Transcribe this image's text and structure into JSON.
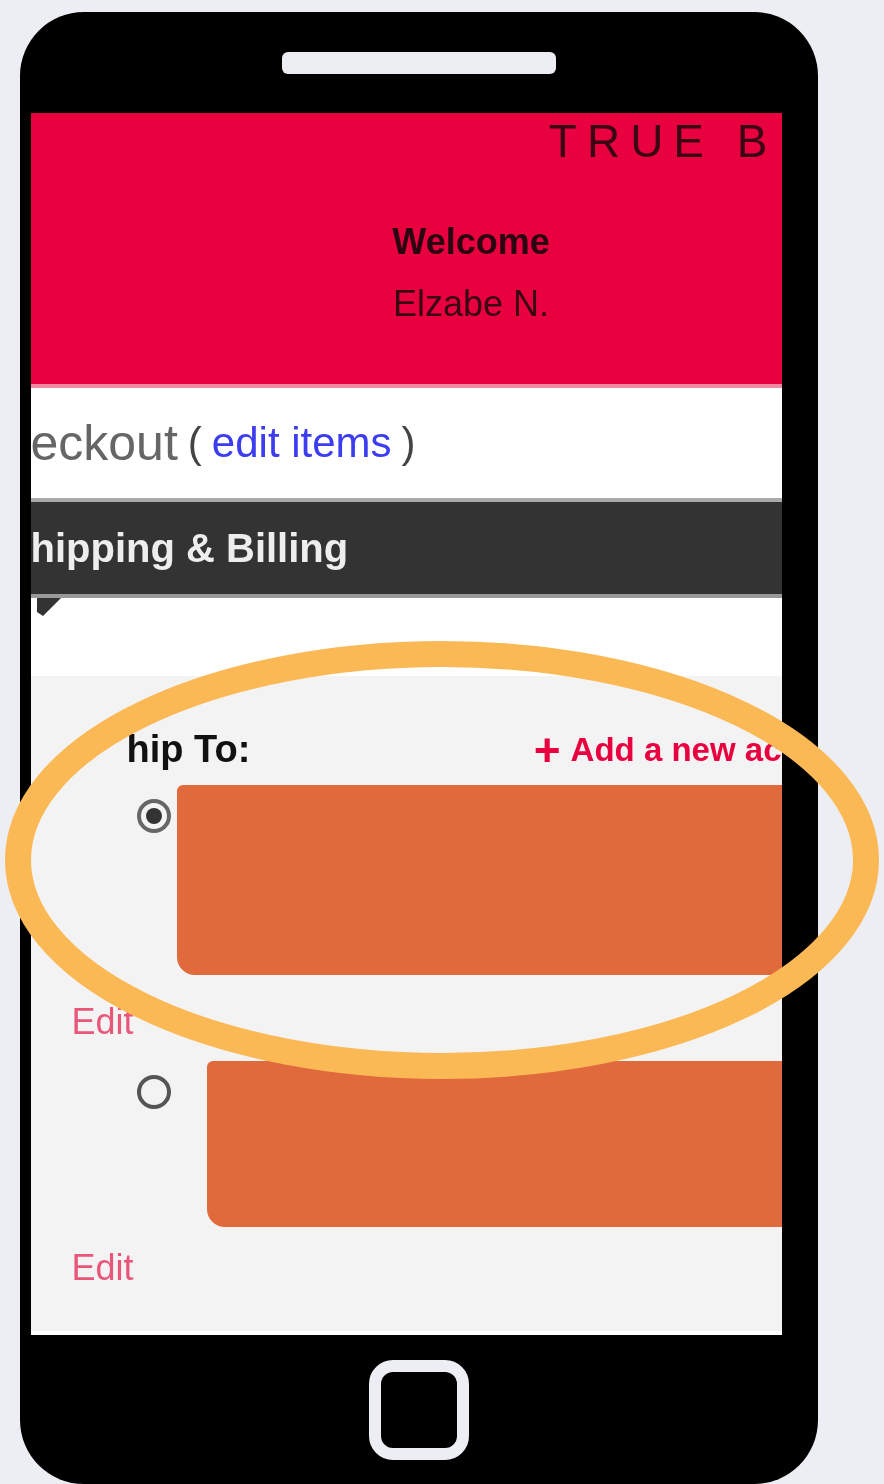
{
  "header": {
    "brand": "TRUE B",
    "welcome": "Welcome",
    "user_name": "Elzabe N."
  },
  "checkout": {
    "title": "eckout",
    "open_paren": "(",
    "link": "edit items",
    "close_paren": ")"
  },
  "section_bar": {
    "title": "hipping & Billing"
  },
  "ship_to": {
    "label": "hip To:",
    "add_icon": "+",
    "add_link": "Add a new ac",
    "addresses": [
      {
        "selected": true,
        "edit": "Edit"
      },
      {
        "selected": false,
        "edit": "Edit"
      }
    ]
  },
  "annotation": {
    "kind": "ellipse"
  }
}
